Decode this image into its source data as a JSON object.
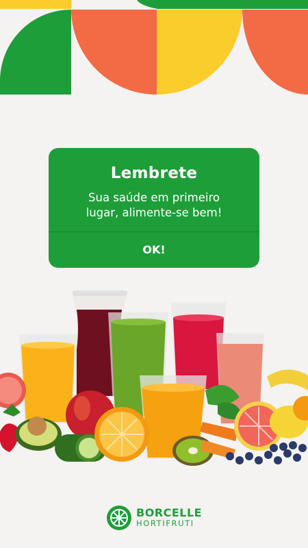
{
  "alert": {
    "title": "Lembrete",
    "message_line1": "Sua saúde em primeiro",
    "message_line2": "lugar, alimente-se bem!",
    "ok_label": "OK!"
  },
  "brand": {
    "name": "BORCELLE",
    "subtitle": "HORTIFRUTI",
    "logo_icon": "citrus-slice-icon"
  },
  "colors": {
    "background": "#f4f3f1",
    "green": "#1e9e38",
    "orange": "#f26b45",
    "yellow": "#fbcd2c"
  }
}
